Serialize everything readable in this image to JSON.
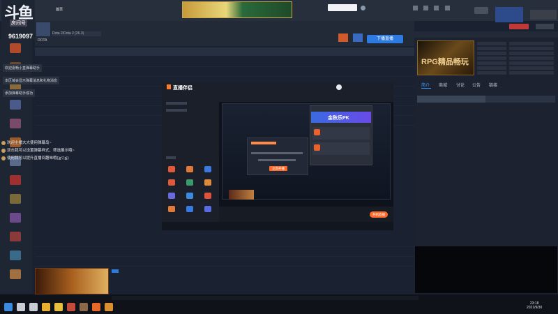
{
  "app": {
    "logo_text": "斗鱼",
    "room_label": "房间号",
    "room_id": "9619097"
  },
  "top_tabs": [
    "",
    "",
    "首页",
    "",
    "",
    "",
    "",
    "",
    "",
    ""
  ],
  "banner": {
    "title": "",
    "subtitle": "",
    "extra": ""
  },
  "ad": {
    "text1": "",
    "text2": ""
  },
  "info_strip": {
    "name_line": "",
    "category": "Dota 2/Dota 2 (26.3)",
    "sub": "",
    "level": "",
    "stats": ""
  },
  "buttons": {
    "record": "",
    "start_live": "下播直播",
    "small": ""
  },
  "column_headers": [
    "",
    "",
    "",
    "",
    "",
    "",
    "",
    ""
  ],
  "sidebar": {
    "items": [
      {
        "label": "",
        "color": "#b04a2a"
      },
      {
        "label": "",
        "color": "#6a4a2a"
      },
      {
        "label": "",
        "color": "#8a6a3a"
      },
      {
        "label": "",
        "color": "#4a5a8a"
      },
      {
        "label": "",
        "color": "#7a4a6a"
      },
      {
        "label": "",
        "color": "#9a5a2a"
      },
      {
        "label": "",
        "color": "#5a6a8a"
      },
      {
        "label": "",
        "color": "#a03030"
      },
      {
        "label": "",
        "color": "#7a6a3a"
      },
      {
        "label": "",
        "color": "#6a4a8a"
      },
      {
        "label": "",
        "color": "#8a3a3a"
      },
      {
        "label": "",
        "color": "#3a6a8a"
      },
      {
        "label": "",
        "color": "#a07040"
      }
    ]
  },
  "notifications": [
    "欢迎嘉畅小直弹幕助手",
    "本区域会显示弹幕消息和礼物消息",
    "添加弹幕助手成功"
  ],
  "chat": [
    {
      "name": "",
      "text": "欢迎主播大大使用弹幕岛~"
    },
    {
      "name": "",
      "text": "双击我可以设置弹幕样式、筛选展示哦~"
    },
    {
      "name": "",
      "text": "使用我可以提升直播间趣味哦(≧▽≦)"
    }
  ],
  "right_panel": {
    "cover_text": "RPG精品畅玩",
    "cover_top": "",
    "tabs": [
      "简介",
      "商城",
      "讨论",
      "公告",
      "链接"
    ],
    "sub_tabs": [
      "",
      ""
    ],
    "lines": [
      "",
      "",
      "",
      "",
      "",
      "",
      ""
    ]
  },
  "inner_app": {
    "title": "直播伴侣",
    "pk_title": "金秋乐PK",
    "dialog_btn": "立即开播",
    "start_btn": "开始直播",
    "pk_items": [
      "",
      ""
    ]
  },
  "game_banner": {
    "text": ""
  },
  "notice_bar": {
    "text": ""
  },
  "taskbar": {
    "time": "23:18",
    "date": "2021/9/30",
    "icons": [
      {
        "name": "windows-icon",
        "color": "#3a8adf"
      },
      {
        "name": "search-icon",
        "color": "#c8ccd4"
      },
      {
        "name": "task-view-icon",
        "color": "#c8ccd4"
      },
      {
        "name": "chrome-icon",
        "color": "#e8b030"
      },
      {
        "name": "folder-icon",
        "color": "#e8c040"
      },
      {
        "name": "app-icon",
        "color": "#c44a3a"
      },
      {
        "name": "app-icon",
        "color": "#8a6a4a"
      },
      {
        "name": "app-icon",
        "color": "#e86a2a"
      },
      {
        "name": "app-icon",
        "color": "#d89030"
      }
    ]
  },
  "colors": {
    "accent": "#2d7be0",
    "brand_orange": "#ff6a2a",
    "bg": "#1a2130"
  }
}
